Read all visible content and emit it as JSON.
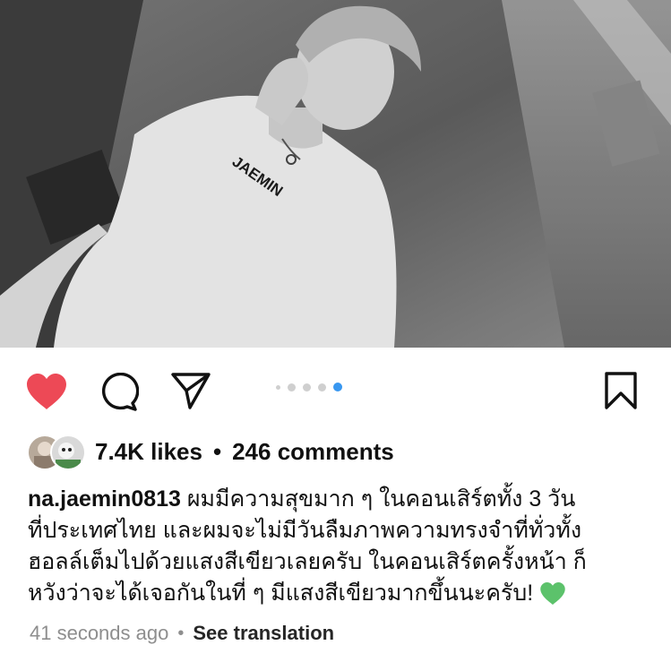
{
  "post": {
    "image_alt": "Black-and-white photo of a person in a white t-shirt",
    "shirt_text": "JAEMIN",
    "carousel": {
      "count": 5,
      "active_index": 4
    },
    "likes_label": "7.4K likes",
    "separator": "•",
    "comments_label": "246 comments",
    "username": "na.jaemin0813",
    "caption_lines": [
      "ผมมีความสุขมาก ๆ ในคอนเสิร์ตทั้ง 3 วัน",
      "ที่ประเทศไทย และผมจะไม่มีวันลืมภาพความทรงจำที่ทั่วทั้ง",
      "ฮอลล์เต็มไปด้วยแสงสีเขียวเลยครับ ในคอนเสิร์ตครั้งหน้า ก็",
      "หวังว่าจะได้เจอกันในที่ ๆ มีแสงสีเขียวมากขึ้นนะครับ!"
    ],
    "caption_emoji": "green-heart-icon",
    "timestamp": "41 seconds ago",
    "meta_separator": "•",
    "translate_label": "See translation"
  },
  "icons": {
    "like": "heart-filled-icon",
    "comment": "comment-bubble-icon",
    "share": "paper-plane-icon",
    "save": "bookmark-icon"
  },
  "colors": {
    "like_red": "#ed4956",
    "carousel_active": "#3897f0",
    "carousel_inactive": "#cfcfcf",
    "muted_text": "#8e8e8e",
    "emoji_green": "#5cc26b"
  }
}
